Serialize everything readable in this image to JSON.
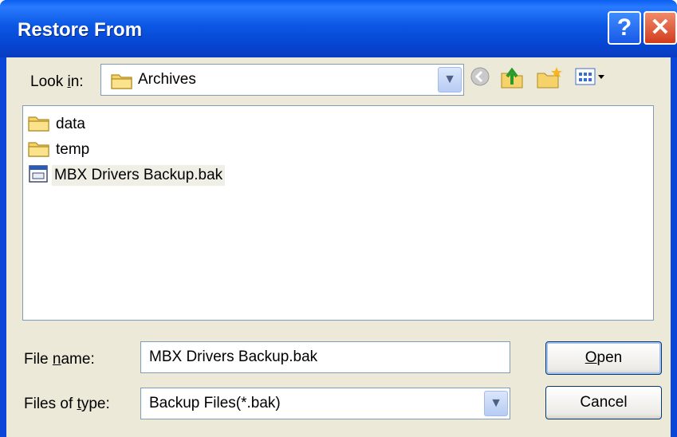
{
  "window": {
    "title": "Restore From"
  },
  "titlebar_buttons": {
    "help": "?",
    "close": "✕"
  },
  "look_in": {
    "label": "Look in:",
    "label_pre": "Look ",
    "label_accel": "i",
    "label_post": "n:",
    "value": "Archives"
  },
  "toolbar": {
    "icons": [
      "back-icon",
      "up-folder-icon",
      "new-folder-icon",
      "views-menu-icon"
    ]
  },
  "files": [
    {
      "name": "data",
      "type": "folder"
    },
    {
      "name": "temp",
      "type": "folder"
    },
    {
      "name": "MBX Drivers Backup.bak",
      "type": "file",
      "selected": true
    }
  ],
  "file_name": {
    "label": "File name:",
    "label_pre": "File ",
    "label_accel": "n",
    "label_post": "ame:",
    "value": "MBX Drivers Backup.bak"
  },
  "file_type": {
    "label": "Files of type:",
    "label_pre": "Files of ",
    "label_accel": "t",
    "label_post": "ype:",
    "value": "Backup Files(*.bak)"
  },
  "buttons": {
    "open_accel": "O",
    "open_rest": "pen",
    "open": "Open",
    "cancel": "Cancel"
  },
  "colors": {
    "titlebar": "#0a46d8",
    "dialog_bg": "#ece9d8",
    "close_btn": "#d23c1c",
    "field_border": "#7f9db9"
  }
}
